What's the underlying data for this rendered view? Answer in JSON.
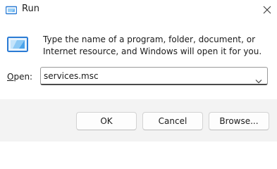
{
  "window": {
    "title": "Run",
    "close_symbol": "✕",
    "icons": {
      "title": "run-app-icon",
      "close": "close-icon",
      "body": "run-app-icon"
    }
  },
  "body": {
    "description": "Type the name of a program, folder, document, or Internet resource, and Windows will open it for you.",
    "open_label_mnemonic": "O",
    "open_label_rest": "pen:",
    "open_value": "services.msc",
    "dropdown_icon": "chevron-down-icon"
  },
  "buttons": {
    "ok": "OK",
    "cancel": "Cancel",
    "browse": "Browse..."
  },
  "colors": {
    "dialog_bg": "#ffffff",
    "footer_bg": "#f3f3f3",
    "accent_blue": "#2b7bd4"
  }
}
